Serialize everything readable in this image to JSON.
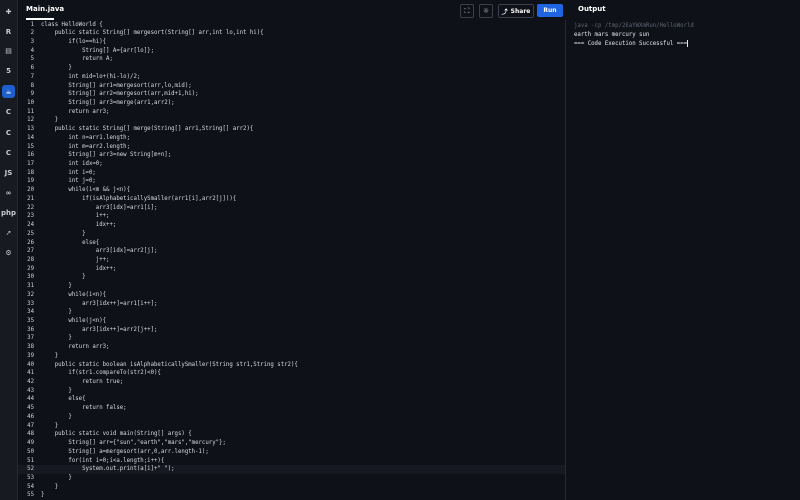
{
  "sidebar": {
    "items": [
      {
        "icon": "python-icon",
        "glyph": "✚"
      },
      {
        "icon": "r-icon",
        "glyph": "R"
      },
      {
        "icon": "database-icon",
        "glyph": "▤"
      },
      {
        "icon": "html5-icon",
        "glyph": "5"
      },
      {
        "icon": "java-icon",
        "glyph": "☕"
      },
      {
        "icon": "c-icon",
        "glyph": "C"
      },
      {
        "icon": "cpp-icon",
        "glyph": "C"
      },
      {
        "icon": "csharp-icon",
        "glyph": "C"
      },
      {
        "icon": "javascript-icon",
        "glyph": "JS"
      },
      {
        "icon": "go-icon",
        "glyph": "∞"
      },
      {
        "icon": "php-icon",
        "glyph": "php"
      },
      {
        "icon": "swift-icon",
        "glyph": "➚"
      },
      {
        "icon": "rust-icon",
        "glyph": "⚙"
      }
    ]
  },
  "header": {
    "file_tab": "Main.java",
    "share_label": "Share",
    "run_label": "Run",
    "output_title": "Output"
  },
  "editor": {
    "current_line": 52,
    "lines": [
      "class HelloWorld {",
      "    public static String[] mergesort(String[] arr,int lo,int hi){",
      "        if(lo==hi){",
      "            String[] A={arr[lo]};",
      "            return A;",
      "        }",
      "        int mid=lo+(hi-lo)/2;",
      "        String[] arr1=mergesort(arr,lo,mid);",
      "        String[] arr2=mergesort(arr,mid+1,hi);",
      "        String[] arr3=merge(arr1,arr2);",
      "        return arr3;",
      "    }",
      "    public static String[] merge(String[] arr1,String[] arr2){",
      "        int n=arr1.length;",
      "        int m=arr2.length;",
      "        String[] arr3=new String[m+n];",
      "        int idx=0;",
      "        int i=0;",
      "        int j=0;",
      "        while(i<m && j<n){",
      "            if(isAlphabeticallySmaller(arr1[i],arr2[j])){",
      "                arr3[idx]=arr1[i];",
      "                i++;",
      "                idx++;",
      "            }",
      "            else{",
      "                arr3[idx]=arr2[j];",
      "                j++;",
      "                idx++;",
      "            }",
      "        }",
      "        while(i<n){",
      "            arr3[idx++]=arr1[i++];",
      "        }",
      "        while(j<n){",
      "            arr3[idx++]=arr2[j++];",
      "        }",
      "        return arr3;",
      "    }",
      "    public static boolean isAlphabeticallySmaller(String str1,String str2){",
      "        if(str1.compareTo(str2)<0){",
      "            return true;",
      "        }",
      "        else{",
      "            return false;",
      "        }",
      "    }",
      "    public static void main(String[] args) {",
      "        String[] arr={\"sun\",\"earth\",\"mars\",\"mercury\"};",
      "        String[] a=mergesort(arr,0,arr.length-1);",
      "        for(int i=0;i<a.length;i++){",
      "            System.out.print(a[i]+\" \");",
      "        }",
      "    }",
      "}"
    ]
  },
  "output": {
    "command": "java -cp /tmp/2EaYWXmRun/HelloWorld",
    "result": "earth mars mercury sun",
    "status": "=== Code Execution Successful ==="
  }
}
